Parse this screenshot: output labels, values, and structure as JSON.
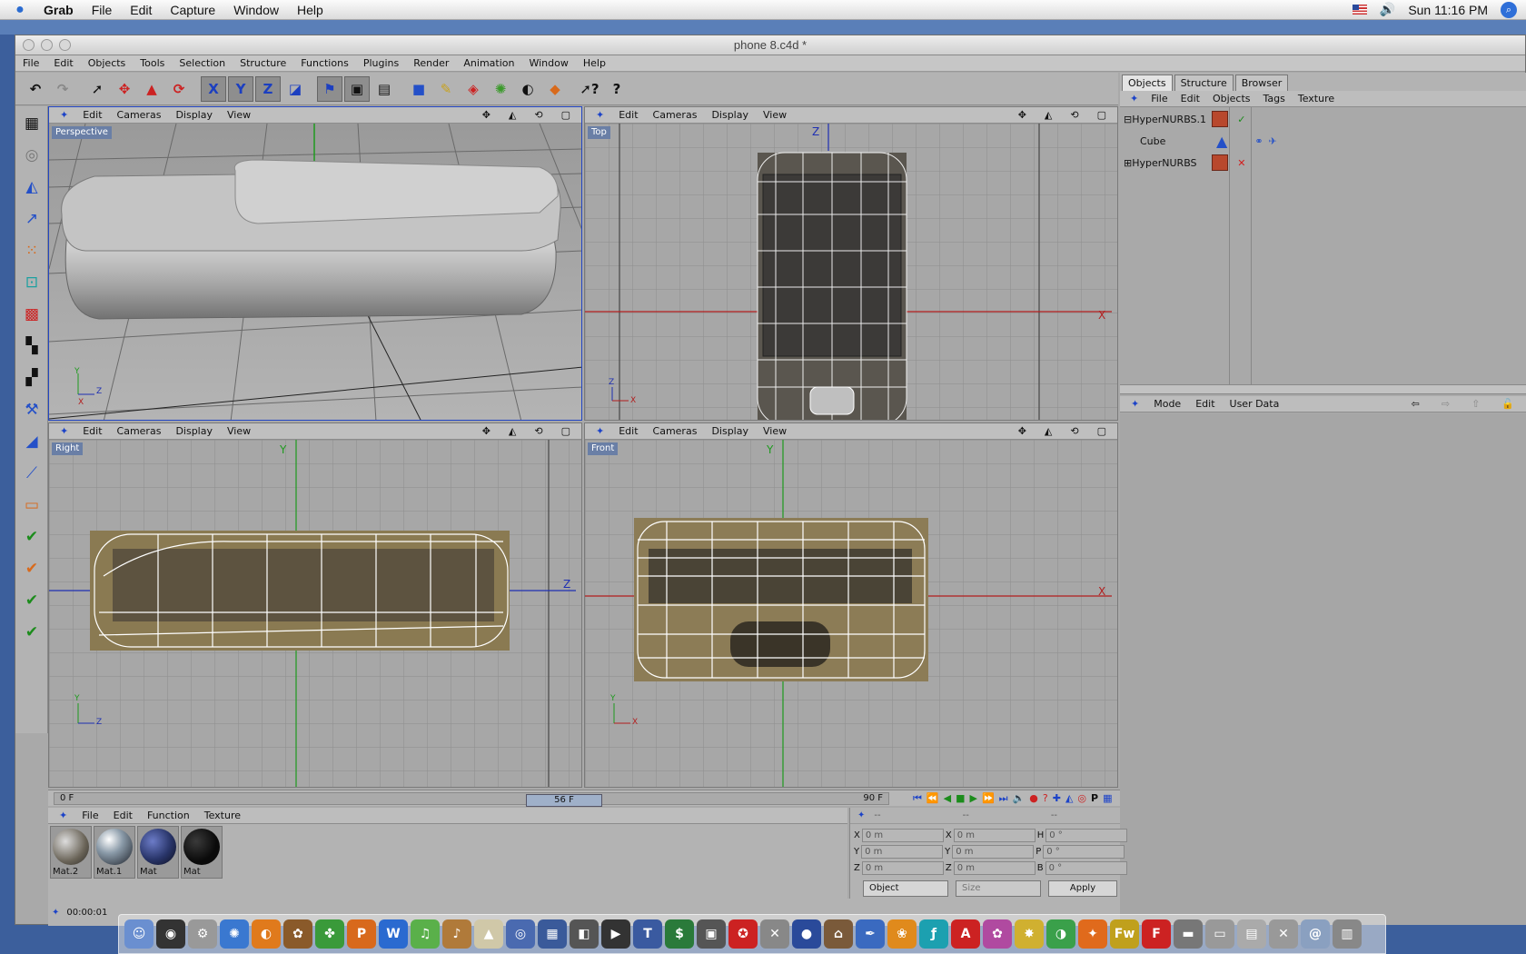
{
  "menubar": {
    "app": "Grab",
    "items": [
      "File",
      "Edit",
      "Capture",
      "Window",
      "Help"
    ],
    "clock": "Sun 11:16 PM"
  },
  "window": {
    "title": "phone 8.c4d *"
  },
  "app_menu": [
    "File",
    "Edit",
    "Objects",
    "Tools",
    "Selection",
    "Structure",
    "Functions",
    "Plugins",
    "Render",
    "Animation",
    "Window",
    "Help"
  ],
  "viewport_menu": [
    "Edit",
    "Cameras",
    "Display",
    "View"
  ],
  "viewports": {
    "perspective": "Perspective",
    "top": "Top",
    "right": "Right",
    "front": "Front"
  },
  "axes": {
    "x": "X",
    "y": "Y",
    "z": "Z"
  },
  "objects_panel": {
    "tabs": [
      "Objects",
      "Structure",
      "Browser"
    ],
    "menu": [
      "File",
      "Edit",
      "Objects",
      "Tags",
      "Texture"
    ],
    "items": [
      {
        "name": "HyperNURBS.1"
      },
      {
        "name": "Cube"
      },
      {
        "name": "HyperNURBS"
      }
    ]
  },
  "attributes_panel": {
    "menu": [
      "Mode",
      "Edit",
      "User Data"
    ]
  },
  "timeline": {
    "start": "0 F",
    "current": "56 F",
    "end": "90 F"
  },
  "materials": {
    "menu": [
      "File",
      "Edit",
      "Function",
      "Texture"
    ],
    "items": [
      "Mat.2",
      "Mat.1",
      "Mat",
      "Mat"
    ]
  },
  "coords": {
    "headers": [
      "--",
      "--",
      "--"
    ],
    "rows": [
      [
        "X",
        "0 m",
        "X",
        "0 m",
        "H",
        "0 °"
      ],
      [
        "Y",
        "0 m",
        "Y",
        "0 m",
        "P",
        "0 °"
      ],
      [
        "Z",
        "0 m",
        "Z",
        "0 m",
        "B",
        "0 °"
      ]
    ],
    "mode": "Object",
    "size": "Size",
    "apply": "Apply"
  },
  "status": {
    "time": "00:00:01"
  },
  "colors": {
    "accent": "#2346c4",
    "x_axis": "#b21e1e",
    "y_axis": "#1e9a1e",
    "z_axis": "#1e2fb2"
  }
}
